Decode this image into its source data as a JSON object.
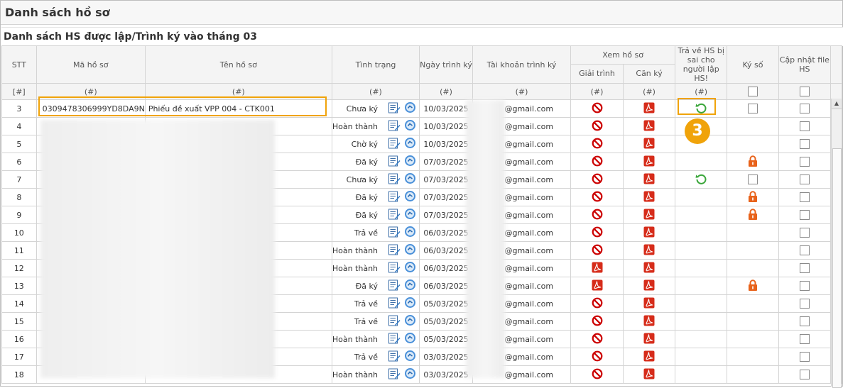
{
  "panel": {
    "title": "Danh sách hồ sơ"
  },
  "subtitle": "Danh sách HS được lập/Trình ký vào tháng 03",
  "headers": {
    "stt": "STT",
    "ma": "Mã hồ sơ",
    "ten": "Tên hồ sơ",
    "tinhtrang": "Tình trạng",
    "ngay": "Ngày trình ký",
    "taikhoan": "Tài khoản trình ký",
    "xem": "Xem hồ sơ",
    "giaitrinh": "Giải trình",
    "canky": "Căn ký",
    "trave": "Trả về HS bị sai cho người lập HS!",
    "kyso": "Ký số",
    "capnhat": "Cập nhật file HS"
  },
  "filter": {
    "stt": "[#]",
    "hash": "(#)"
  },
  "rows": [
    {
      "stt": "3",
      "ma": "0309478306999YD8DA9N",
      "ten": "Phiếu đề xuất VPP 004 - CTK001",
      "status": "Chưa ký",
      "date": "10/03/2025",
      "email": "@gmail.com",
      "giaitrinh": "no",
      "canky": "pdf",
      "trave": "return",
      "kyso": "checkbox",
      "capnhat": "checkbox"
    },
    {
      "stt": "4",
      "ma": "",
      "ten": "",
      "status": "Hoàn thành",
      "date": "10/03/2025",
      "email": "@gmail.com",
      "giaitrinh": "no",
      "canky": "pdf",
      "trave": "",
      "kyso": "",
      "capnhat": "checkbox"
    },
    {
      "stt": "5",
      "ma": "",
      "ten": "",
      "status": "Chờ ký",
      "date": "10/03/2025",
      "email": "@gmail.com",
      "giaitrinh": "no",
      "canky": "pdf",
      "trave": "",
      "kyso": "",
      "capnhat": "checkbox"
    },
    {
      "stt": "6",
      "ma": "",
      "ten": "",
      "status": "Đã ký",
      "date": "07/03/2025",
      "email": "@gmail.com",
      "giaitrinh": "no",
      "canky": "pdf",
      "trave": "",
      "kyso": "lock",
      "capnhat": "checkbox"
    },
    {
      "stt": "7",
      "ma": "",
      "ten": "",
      "status": "Chưa ký",
      "date": "07/03/2025",
      "email": "@gmail.com",
      "giaitrinh": "no",
      "canky": "pdf",
      "trave": "return",
      "kyso": "checkbox",
      "capnhat": "checkbox"
    },
    {
      "stt": "8",
      "ma": "",
      "ten": "",
      "status": "Đã ký",
      "date": "07/03/2025",
      "email": "@gmail.com",
      "giaitrinh": "no",
      "canky": "pdf",
      "trave": "",
      "kyso": "lock",
      "capnhat": "checkbox"
    },
    {
      "stt": "9",
      "ma": "",
      "ten": "",
      "status": "Đã ký",
      "date": "07/03/2025",
      "email": "@gmail.com",
      "giaitrinh": "no",
      "canky": "pdf",
      "trave": "",
      "kyso": "lock",
      "capnhat": "checkbox"
    },
    {
      "stt": "10",
      "ma": "",
      "ten": "",
      "status": "Trả về",
      "date": "06/03/2025",
      "email": "@gmail.com",
      "giaitrinh": "no",
      "canky": "pdf",
      "trave": "",
      "kyso": "",
      "capnhat": "checkbox"
    },
    {
      "stt": "11",
      "ma": "",
      "ten": "",
      "status": "Hoàn thành",
      "date": "06/03/2025",
      "email": "@gmail.com",
      "giaitrinh": "no",
      "canky": "pdf",
      "trave": "",
      "kyso": "",
      "capnhat": "checkbox"
    },
    {
      "stt": "12",
      "ma": "",
      "ten": "",
      "status": "Hoàn thành",
      "date": "06/03/2025",
      "email": "@gmail.com",
      "giaitrinh": "pdf",
      "canky": "pdf",
      "trave": "",
      "kyso": "",
      "capnhat": "checkbox"
    },
    {
      "stt": "13",
      "ma": "",
      "ten": "",
      "status": "Đã ký",
      "date": "06/03/2025",
      "email": "@gmail.com",
      "giaitrinh": "pdf",
      "canky": "pdf",
      "trave": "",
      "kyso": "lock",
      "capnhat": "checkbox"
    },
    {
      "stt": "14",
      "ma": "",
      "ten": "",
      "status": "Trả về",
      "date": "05/03/2025",
      "email": "@gmail.com",
      "giaitrinh": "no",
      "canky": "pdf",
      "trave": "",
      "kyso": "",
      "capnhat": "checkbox"
    },
    {
      "stt": "15",
      "ma": "",
      "ten": "",
      "status": "Trả về",
      "date": "05/03/2025",
      "email": "@gmail.com",
      "giaitrinh": "no",
      "canky": "pdf",
      "trave": "",
      "kyso": "",
      "capnhat": "checkbox"
    },
    {
      "stt": "16",
      "ma": "",
      "ten": "",
      "status": "Hoàn thành",
      "date": "05/03/2025",
      "email": "@gmail.com",
      "giaitrinh": "no",
      "canky": "pdf",
      "trave": "",
      "kyso": "",
      "capnhat": "checkbox"
    },
    {
      "stt": "17",
      "ma": "",
      "ten": "",
      "status": "Trả về",
      "date": "03/03/2025",
      "email": "@gmail.com",
      "giaitrinh": "no",
      "canky": "pdf",
      "trave": "",
      "kyso": "",
      "capnhat": "checkbox"
    },
    {
      "stt": "18",
      "ma": "",
      "ten": "",
      "status": "Hoàn thành",
      "date": "03/03/2025",
      "email": "@gmail.com",
      "giaitrinh": "no",
      "canky": "pdf",
      "trave": "",
      "kyso": "",
      "capnhat": "checkbox"
    }
  ],
  "annotation": {
    "step": "3"
  },
  "colors": {
    "highlight": "#f0a30a",
    "no_sign": "#cc0000",
    "pdf": "#d62c1a",
    "return": "#3aa63a",
    "lock": "#e8621a"
  }
}
